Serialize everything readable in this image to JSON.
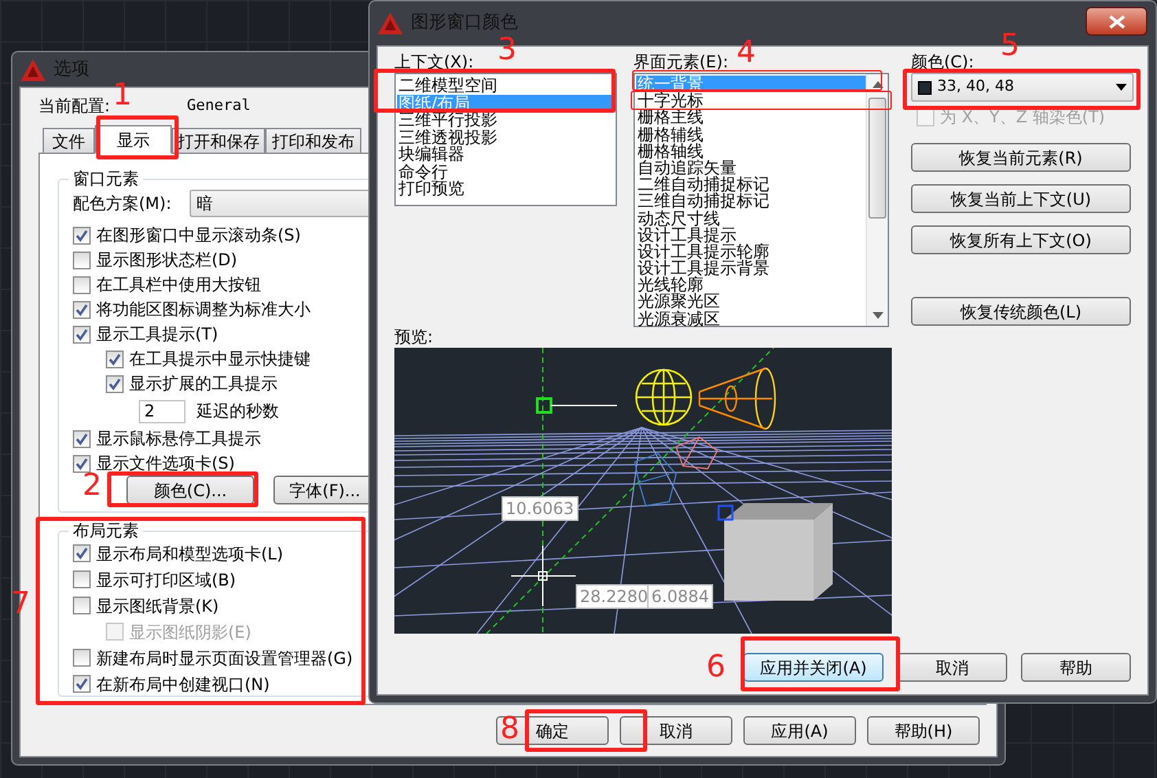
{
  "options": {
    "title": "选项",
    "profile_label": "当前配置:",
    "profile_value": "General",
    "tabs": [
      {
        "label": "文件",
        "selected": false
      },
      {
        "label": "显示",
        "selected": true
      },
      {
        "label": "打开和保存",
        "selected": false
      },
      {
        "label": "打印和发布",
        "selected": false
      }
    ],
    "window_elements": {
      "title": "窗口元素",
      "scheme_label": "配色方案(M):",
      "scheme_value": "暗",
      "items": [
        {
          "kind": "checkbox",
          "label": "在图形窗口中显示滚动条(S)",
          "checked": true,
          "disabled": false
        },
        {
          "kind": "checkbox",
          "label": "显示图形状态栏(D)",
          "checked": false,
          "disabled": false
        },
        {
          "kind": "checkbox",
          "label": "在工具栏中使用大按钮",
          "checked": false,
          "disabled": false
        },
        {
          "kind": "checkbox",
          "label": "将功能区图标调整为标准大小",
          "checked": true,
          "disabled": false
        },
        {
          "kind": "checkbox",
          "label": "显示工具提示(T)",
          "checked": true,
          "disabled": false,
          "children": [
            {
              "kind": "checkbox",
              "label": "在工具提示中显示快捷键",
              "checked": true,
              "disabled": false
            },
            {
              "kind": "checkbox",
              "label": "显示扩展的工具提示",
              "checked": true,
              "disabled": false,
              "children": [
                {
                  "kind": "spinner",
                  "value": "2",
                  "label": "延迟的秒数"
                }
              ]
            }
          ]
        },
        {
          "kind": "checkbox",
          "label": "显示鼠标悬停工具提示",
          "checked": true,
          "disabled": false
        },
        {
          "kind": "checkbox",
          "label": "显示文件选项卡(S)",
          "checked": true,
          "disabled": false
        }
      ],
      "buttons": [
        "颜色(C)...",
        "字体(F)..."
      ]
    },
    "layout_elements": {
      "title": "布局元素",
      "items": [
        {
          "kind": "checkbox",
          "label": "显示布局和模型选项卡(L)",
          "checked": true,
          "disabled": false
        },
        {
          "kind": "checkbox",
          "label": "显示可打印区域(B)",
          "checked": false,
          "disabled": false
        },
        {
          "kind": "checkbox",
          "label": "显示图纸背景(K)",
          "checked": false,
          "disabled": false,
          "children": [
            {
              "kind": "checkbox",
              "label": "显示图纸阴影(E)",
              "checked": false,
              "disabled": true
            }
          ]
        },
        {
          "kind": "checkbox",
          "label": "新建布局时显示页面设置管理器(G)",
          "checked": false,
          "disabled": false
        },
        {
          "kind": "checkbox",
          "label": "在新布局中创建视口(N)",
          "checked": true,
          "disabled": false
        }
      ]
    },
    "buttons": [
      "确定",
      "取消",
      "应用(A)",
      "帮助(H)"
    ]
  },
  "graphics_dialog": {
    "title": "图形窗口颜色",
    "context": {
      "label": "上下文(X):",
      "items": [
        {
          "label": "二维模型空间",
          "selected": false
        },
        {
          "label": "图纸/布局",
          "selected": true
        },
        {
          "label": "三维平行投影",
          "selected": false
        },
        {
          "label": "三维透视投影",
          "selected": false
        },
        {
          "label": "块编辑器",
          "selected": false
        },
        {
          "label": "命令行",
          "selected": false
        },
        {
          "label": "打印预览",
          "selected": false
        }
      ]
    },
    "elements": {
      "label": "界面元素(E):",
      "items": [
        {
          "label": "统一背景",
          "selected": true
        },
        {
          "label": "十字光标",
          "selected": false
        },
        {
          "label": "栅格主线",
          "selected": false
        },
        {
          "label": "栅格辅线",
          "selected": false
        },
        {
          "label": "栅格轴线",
          "selected": false
        },
        {
          "label": "自动追踪矢量",
          "selected": false
        },
        {
          "label": "二维自动捕捉标记",
          "selected": false
        },
        {
          "label": "三维自动捕捉标记",
          "selected": false
        },
        {
          "label": "动态尺寸线",
          "selected": false
        },
        {
          "label": "设计工具提示",
          "selected": false
        },
        {
          "label": "设计工具提示轮廓",
          "selected": false
        },
        {
          "label": "设计工具提示背景",
          "selected": false
        },
        {
          "label": "光线轮廓",
          "selected": false
        },
        {
          "label": "光源聚光区",
          "selected": false
        },
        {
          "label": "光源衰减区",
          "selected": false
        }
      ]
    },
    "color": {
      "label": "颜色(C):",
      "value": "33, 40, 48",
      "tint_label": "为 X、Y、Z 轴染色(T)",
      "tint_checked": false,
      "tint_disabled": true
    },
    "restore_buttons": [
      "恢复当前元素(R)",
      "恢复当前上下文(U)",
      "恢复所有上下文(O)",
      "恢复传统颜色(L)"
    ],
    "preview": {
      "label": "预览:",
      "readouts": [
        "10.6063",
        "28.2280",
        "6.0884"
      ]
    },
    "buttons": [
      {
        "label": "应用并关闭(A)",
        "focused": true
      },
      {
        "label": "取消",
        "focused": false
      },
      {
        "label": "帮助",
        "focused": false
      }
    ]
  },
  "annotations": [
    {
      "label": "1"
    },
    {
      "label": "2"
    },
    {
      "label": "3"
    },
    {
      "label": "4"
    },
    {
      "label": "5"
    },
    {
      "label": "6"
    },
    {
      "label": "7"
    },
    {
      "label": "8"
    }
  ]
}
